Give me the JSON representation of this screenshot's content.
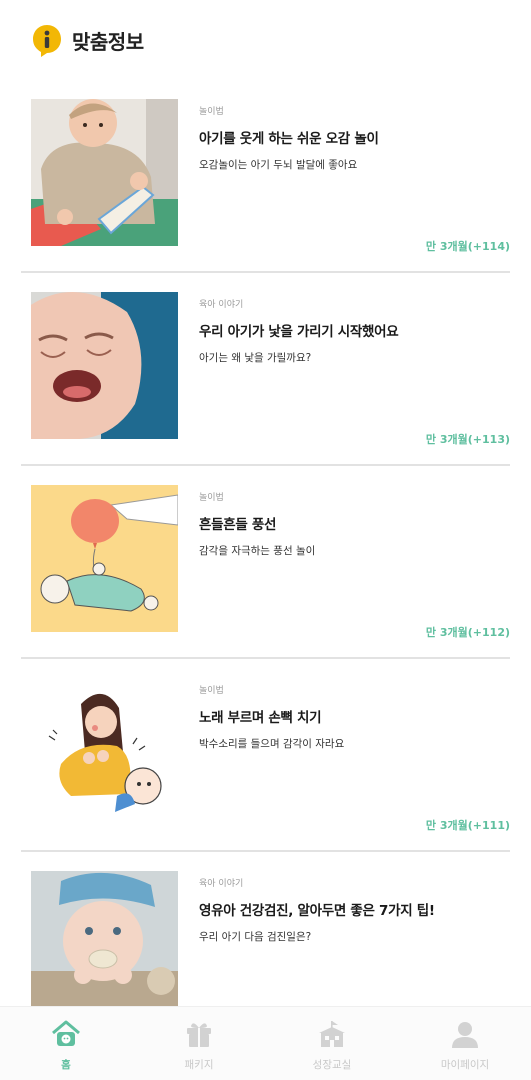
{
  "header": {
    "title": "맞춤정보",
    "logo_icon": "info-bubble-icon",
    "logo_color": "#f2b705"
  },
  "colors": {
    "accent": "#5fbf9f",
    "inactive": "#c8c8c8",
    "divider": "#e2e2e2"
  },
  "feed": {
    "items": [
      {
        "category": "놀이법",
        "title": "아기를 웃게 하는 쉬운 오감 놀이",
        "description": "오감놀이는 아기 두뇌 발달에 좋아요",
        "age": "만 3개월(+114)",
        "thumbnail": "baby-with-book-photo"
      },
      {
        "category": "육아 이야기",
        "title": "우리 아기가 낯을 가리기 시작했어요",
        "description": "아기는 왜 낯을 가릴까요?",
        "age": "만 3개월(+113)",
        "thumbnail": "crying-baby-photo"
      },
      {
        "category": "놀이법",
        "title": "흔들흔들 풍선",
        "description": "감각을 자극하는 풍선 놀이",
        "age": "만 3개월(+112)",
        "thumbnail": "balloon-baby-illustration"
      },
      {
        "category": "놀이법",
        "title": "노래 부르며 손뼉 치기",
        "description": "박수소리를 들으며 감각이 자라요",
        "age": "만 3개월(+111)",
        "thumbnail": "clapping-mother-illustration"
      },
      {
        "category": "육아 이야기",
        "title": "영유아 건강검진, 알아두면 좋은 7가지 팁!",
        "description": "우리 아기 다음 검진일은?",
        "age": "",
        "thumbnail": "baby-pacifier-photo"
      }
    ]
  },
  "tabbar": {
    "tabs": [
      {
        "label": "홈",
        "icon": "home-icon",
        "active": true
      },
      {
        "label": "패키지",
        "icon": "gift-icon",
        "active": false
      },
      {
        "label": "성장교실",
        "icon": "classroom-icon",
        "active": false
      },
      {
        "label": "마이페이지",
        "icon": "person-icon",
        "active": false
      }
    ]
  }
}
